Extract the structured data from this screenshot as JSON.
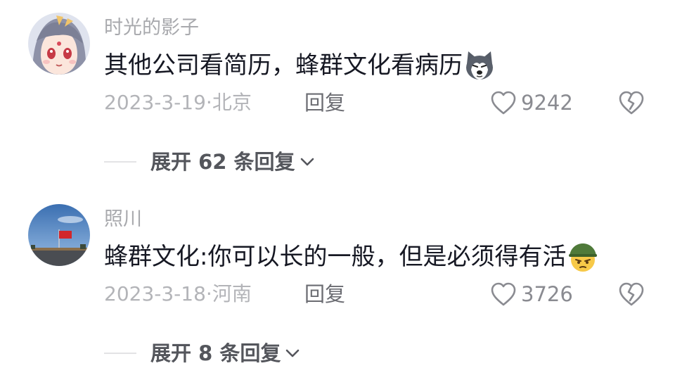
{
  "comments": [
    {
      "username": "时光的影子",
      "text": "其他公司看简历，蜂群文化看病历",
      "emoji": "husky-dog-emoji",
      "date": "2023-3-19",
      "sep": "·",
      "location": "北京",
      "reply_label": "回复",
      "likes": "9242",
      "expand_label": "展开 62 条回复"
    },
    {
      "username": "照川",
      "text": "蜂群文化:你可以长的一般，但是必须得有活",
      "emoji": "soldier-helmet-emoji",
      "date": "2023-3-18",
      "sep": "·",
      "location": "河南",
      "reply_label": "回复",
      "likes": "3726",
      "expand_label": "展开 8 条回复"
    }
  ],
  "icons": {
    "like": "heart-outline-icon",
    "dislike": "broken-heart-icon",
    "expand": "chevron-down-icon"
  },
  "colors": {
    "username": "#a8a9ad",
    "text": "#161823",
    "meta": "#b3b4b8",
    "reply": "#6b6c72",
    "expand": "#54565c"
  }
}
